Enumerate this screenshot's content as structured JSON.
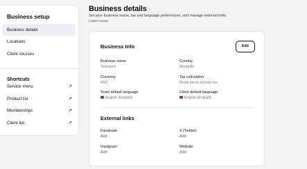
{
  "sidebar": {
    "title": "Business setup",
    "items": [
      {
        "label": "Business details"
      },
      {
        "label": "Locations"
      },
      {
        "label": "Client sources"
      }
    ],
    "shortcuts_title": "Shortcuts",
    "shortcuts": [
      {
        "label": "Service menu",
        "icon": "arrow-up-right-icon"
      },
      {
        "label": "Product list",
        "icon": "arrow-up-right-icon"
      },
      {
        "label": "Memberships",
        "icon": "arrow-up-right-icon"
      },
      {
        "label": "Client list",
        "icon": "arrow-up-right-icon"
      }
    ]
  },
  "header": {
    "title": "Business details",
    "subtitle": "Set your business name, tax and language preferences, and manage external links.",
    "learn_more": "Learn more."
  },
  "business_info": {
    "title": "Business Info",
    "edit_label": "Edit",
    "fields": {
      "business_name": {
        "label": "Business name",
        "value": "Testname"
      },
      "country": {
        "label": "Country",
        "value": "Mongolia"
      },
      "currency": {
        "label": "Currency",
        "value": "MNT"
      },
      "tax_calculation": {
        "label": "Tax calculation",
        "value": "Retail prices include tax"
      },
      "team_language": {
        "label": "Team default language",
        "value": "English (English)",
        "icon": "uk-flag-icon"
      },
      "client_language": {
        "label": "Client default language",
        "value": "English (English)",
        "icon": "uk-flag-icon"
      }
    }
  },
  "external_links": {
    "title": "External links",
    "links": {
      "facebook": {
        "label": "Facebook",
        "action": "Add"
      },
      "twitter": {
        "label": "X (Twitter)",
        "action": "Add"
      },
      "instagram": {
        "label": "Instagram",
        "action": "Add"
      },
      "website": {
        "label": "Website",
        "action": "Add"
      }
    }
  },
  "colors": {
    "accent": "#5b47e8",
    "active_nav": "#eeeef6",
    "background": "#f3f3f4"
  }
}
